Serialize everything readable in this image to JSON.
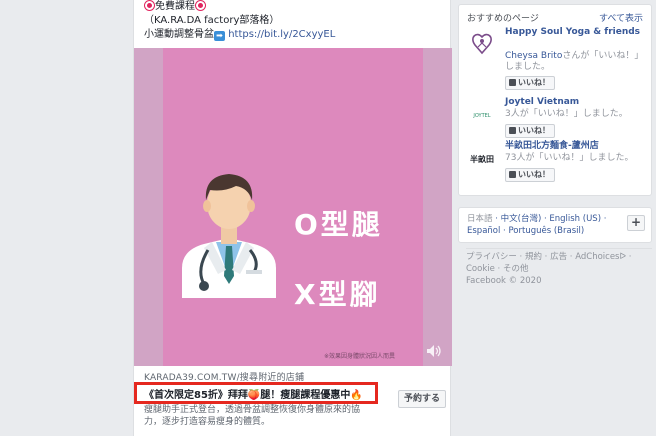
{
  "post": {
    "line1": "免費課程",
    "line2": "（KA.RA.DA factory部落格）",
    "line3_text": "小運動調整骨盆",
    "line3_link": "https://bit.ly/2CxyyEL",
    "image_title1": "O型腿",
    "image_title2": "X型腳",
    "image_note": "※效果因身體狀況因人而異",
    "site": "KARADA39.COM.TW/搜尋附近的店鋪",
    "headline": "《首次限定85折》拜拜",
    "headline_tail": "腿！瘦腿課程優惠中",
    "description": "瘦腿助手正式登台，透過骨盆調整恢復你身體原來的協力，逐步打造容易瘦身的體質。",
    "book_button": "予約する"
  },
  "sidebar": {
    "header": "おすすめのページ",
    "see_all": "すべて表示",
    "pages": [
      {
        "name": "Happy Soul Yoga & friends",
        "sub_name": "Cheysa Brito",
        "sub_tail": "さんが「いいね！」しました。",
        "like": "いいね！"
      },
      {
        "name": "Joytel Vietnam",
        "sub_name": "",
        "sub_tail": "3人が「いいね！」しました。",
        "like": "いいね！"
      },
      {
        "name": "半畝田北方麵食-蘆州店",
        "sub_name": "",
        "sub_tail": "73人が「いいね！」しました。",
        "like": "いいね！"
      }
    ],
    "languages": {
      "current": "日本語",
      "others": [
        "中文(台灣)",
        "English (US)",
        "Español",
        "Português (Brasil)"
      ],
      "plus": "+"
    },
    "footer": {
      "links": [
        "プライバシー",
        "規約",
        "広告",
        "AdChoices",
        "Cookie",
        "その他"
      ],
      "copyright": "Facebook © 2020"
    }
  },
  "colors": {
    "link": "#385898",
    "highlight": "#e5281f",
    "image_bg": "#dd89bd"
  }
}
